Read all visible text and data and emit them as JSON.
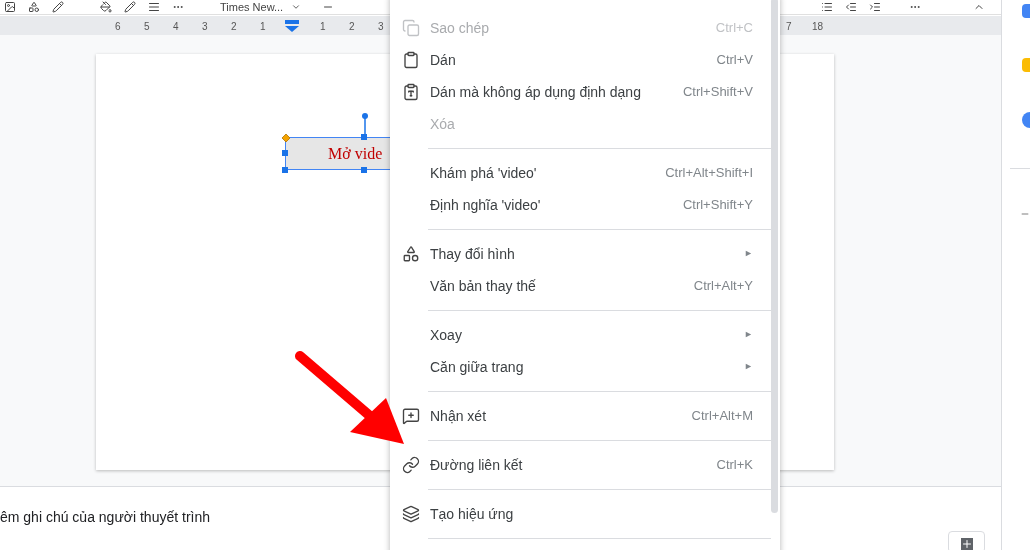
{
  "toolbar": {
    "font_name": "Times New..."
  },
  "ruler": {
    "left_labels": [
      "6",
      "5",
      "4",
      "3",
      "2",
      "1"
    ],
    "right_labels": [
      "1",
      "2",
      "3"
    ],
    "tail_labels": [
      "7",
      "18"
    ]
  },
  "slide": {
    "text_box": "Mở vide"
  },
  "context_menu": [
    {
      "kind": "item",
      "label": "Sao chép",
      "shortcut": "Ctrl+C",
      "disabled": true
    },
    {
      "kind": "item",
      "label": "Dán",
      "shortcut": "Ctrl+V",
      "disabled": false
    },
    {
      "kind": "item",
      "label": "Dán mà không áp dụng định dạng",
      "shortcut": "Ctrl+Shift+V",
      "disabled": false
    },
    {
      "kind": "item",
      "label": "Xóa",
      "disabled": true
    },
    {
      "kind": "separator"
    },
    {
      "kind": "item",
      "label": "Khám phá 'video'",
      "shortcut": "Ctrl+Alt+Shift+I",
      "disabled": false
    },
    {
      "kind": "item",
      "label": "Định nghĩa 'video'",
      "shortcut": "Ctrl+Shift+Y",
      "disabled": false
    },
    {
      "kind": "separator"
    },
    {
      "kind": "item",
      "label": "Thay đổi hình",
      "submenu_arrow": "►",
      "disabled": false
    },
    {
      "kind": "item",
      "label": "Văn bản thay thế",
      "shortcut": "Ctrl+Alt+Y",
      "disabled": false
    },
    {
      "kind": "separator"
    },
    {
      "kind": "item",
      "label": "Xoay",
      "submenu_arrow": "►",
      "disabled": false
    },
    {
      "kind": "item",
      "label": "Căn giữa trang",
      "submenu_arrow": "►",
      "disabled": false
    },
    {
      "kind": "separator"
    },
    {
      "kind": "item",
      "label": "Nhận xét",
      "shortcut": "Ctrl+Alt+M",
      "disabled": false
    },
    {
      "kind": "separator"
    },
    {
      "kind": "item",
      "label": "Đường liên kết",
      "shortcut": "Ctrl+K",
      "disabled": false
    },
    {
      "kind": "separator"
    },
    {
      "kind": "item",
      "label": "Tạo hiệu ứng",
      "disabled": false
    },
    {
      "kind": "separator"
    }
  ],
  "speaker_notes": {
    "placeholder": "êm ghi chú của người thuyết trình"
  }
}
